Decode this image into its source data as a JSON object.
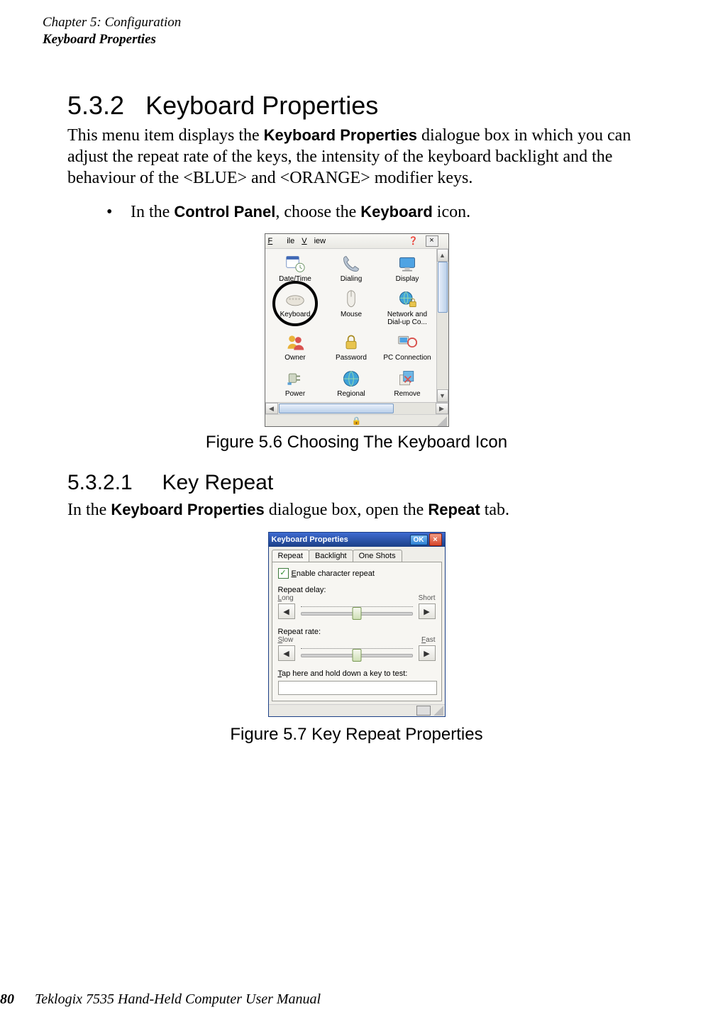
{
  "header": {
    "line1": "Chapter 5: Configuration",
    "line2": "Keyboard Properties"
  },
  "section": {
    "number": "5.3.2",
    "title": "Keyboard Properties",
    "intro_pre": "This menu item displays the ",
    "intro_bold": "Keyboard Properties",
    "intro_post": " dialogue box in which you can adjust the repeat rate of the keys, the intensity of the keyboard backlight and the behaviour of the <BLUE> and <ORANGE> modifier keys.",
    "bullet_pre": "In the ",
    "bullet_b1": "Control Panel",
    "bullet_mid": ", choose the ",
    "bullet_b2": "Keyboard",
    "bullet_post": " icon."
  },
  "figure1": {
    "caption": "Figure 5.6 Choosing The Keyboard Icon",
    "menu": {
      "file": "File",
      "view": "View",
      "help": "?",
      "close": "×"
    },
    "items": {
      "datetime": "Date/Time",
      "dialing": "Dialing",
      "display": "Display",
      "keyboard": "Keyboard",
      "mouse": "Mouse",
      "network": "Network and Dial-up Co...",
      "owner": "Owner",
      "password": "Password",
      "pcconn": "PC Connection",
      "power": "Power",
      "regional": "Regional",
      "remove": "Remove"
    }
  },
  "subsection": {
    "number": "5.3.2.1",
    "title": "Key Repeat",
    "text_pre": "In the ",
    "text_b1": "Keyboard Properties",
    "text_mid": " dialogue box, open the ",
    "text_b2": "Repeat",
    "text_post": " tab."
  },
  "figure2": {
    "caption": "Figure 5.7 Key Repeat Properties",
    "title": "Keyboard Properties",
    "ok": "OK",
    "close": "×",
    "tabs": {
      "repeat": "Repeat",
      "backlight": "Backlight",
      "oneshots": "One Shots"
    },
    "checkbox": "Enable character repeat",
    "delay": {
      "label": "Repeat delay:",
      "left": "Long",
      "right": "Short"
    },
    "rate": {
      "label": "Repeat rate:",
      "left": "Slow",
      "right": "Fast"
    },
    "test": "Tap here and hold down a key to test:"
  },
  "footer": {
    "page": "80",
    "text": "Teklogix 7535 Hand-Held Computer User Manual"
  }
}
